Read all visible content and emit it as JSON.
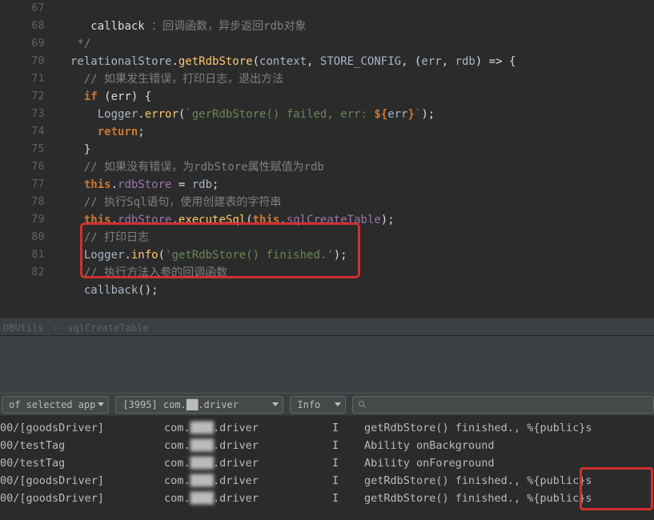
{
  "lineNumbers": [
    "67",
    "68",
    "69",
    "70",
    "71",
    "72",
    "73",
    "74",
    "75",
    "76",
    "77",
    "78",
    "79",
    "80",
    "81",
    "82"
  ],
  "code": {
    "l67": "callback",
    "l67_comment": " ：回调函数，异步返回rdb对象",
    "l68": "*/",
    "l69_obj": "relationalStore",
    "l69_dot": ".",
    "l69_method": "getRdbStore",
    "l69_args_open": "(",
    "l69_arg1": "context",
    "l69_arg2": "STORE_CONFIG",
    "l69_arg3a": "(",
    "l69_arg3b": "err",
    "l69_arg3c": "rdb",
    "l69_arg3d": ") => {",
    "l70_comment": "// 如果发生错误，打印日志，退出方法",
    "l71_if": "if",
    "l71_cond": "(err)",
    "l71_brace": "{",
    "l72_logger": "Logger",
    "l72_method": "error",
    "l72_strA": "`gerRdbStore() failed, err: ",
    "l72_expr_open": "${",
    "l72_expr": "err",
    "l72_expr_close": "}",
    "l72_strB": "`",
    "l73_return": "return",
    "l74_brace": "}",
    "l75_comment": "// 如果没有错误，为rdbStore属性赋值为rdb",
    "l76_this": "this",
    "l76_prop": "rdbStore",
    "l76_eq": " = ",
    "l76_val": "rdb",
    "l77_comment": "// 执行Sql语句，使用创建表的字符串",
    "l78_this": "this",
    "l78_prop": "rdbStore",
    "l78_method": "executeSql",
    "l78_this2": "this",
    "l78_prop2": "sqlCreateTable",
    "l79_comment": "// 打印日志",
    "l80_logger": "Logger",
    "l80_method": "info",
    "l80_str": "'getRdbStore() finished.'",
    "l81_comment": "// 执行方法入参的回调函数",
    "l82_call": "callback",
    "l82_p": "();"
  },
  "breadcrumb": {
    "a": "DBUtils",
    "b": "sqlCreateTable"
  },
  "filters": {
    "app": "of selected app",
    "process": "[3995] com.██.driver",
    "process_obscured": "██",
    "level": "Info",
    "search_placeholder": ""
  },
  "log_obscured": "████",
  "logs": [
    {
      "src": "00/[goodsDriver]",
      "pkg_prefix": "com.",
      "pkg_suffix": ".driver",
      "lvl": "I",
      "msg": "getRdbStore() finished., %{public}s"
    },
    {
      "src": "00/testTag",
      "pkg_prefix": "com.",
      "pkg_suffix": ".driver",
      "lvl": "I",
      "msg": "Ability onBackground"
    },
    {
      "src": "00/testTag",
      "pkg_prefix": "com.",
      "pkg_suffix": ".driver",
      "lvl": "I",
      "msg": "Ability onForeground"
    },
    {
      "src": "00/[goodsDriver]",
      "pkg_prefix": "com.",
      "pkg_suffix": ".driver",
      "lvl": "I",
      "msg": "getRdbStore() finished., %{public}s"
    },
    {
      "src": "00/[goodsDriver]",
      "pkg_prefix": "com.",
      "pkg_suffix": ".driver",
      "lvl": "I",
      "msg": "getRdbStore() finished., %{public}s"
    }
  ]
}
